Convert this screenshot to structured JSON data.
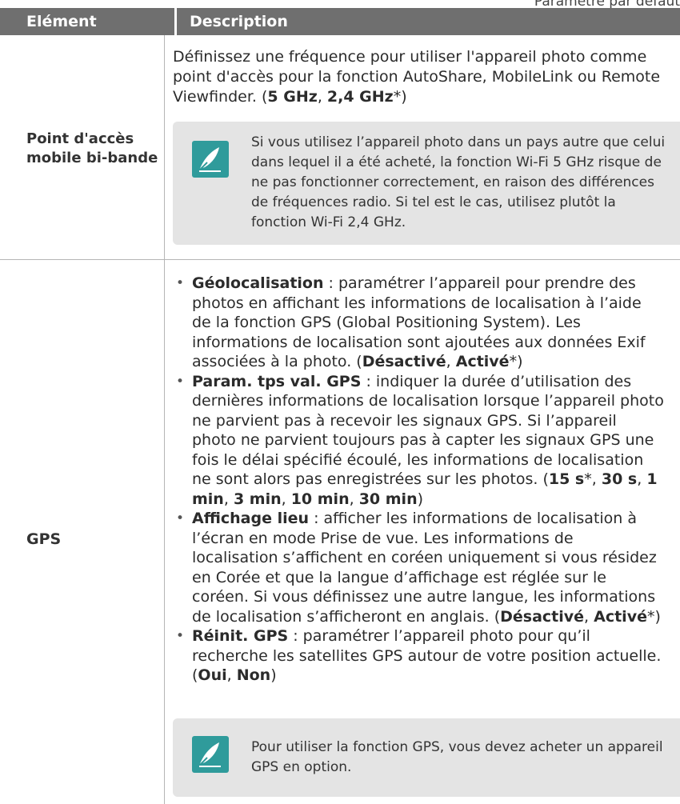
{
  "top_note": "Paramètre par défaut",
  "header": {
    "col1": "Elément",
    "col2": "Description"
  },
  "rows": [
    {
      "label_line1": "Point d'accès",
      "label_line2": "mobile bi-bande",
      "desc_intro": "Définissez une fréquence pour utiliser l'appareil photo comme point d'accès pour la fonction AutoShare, MobileLink ou Remote Viewfinder. (",
      "opt1": "5 GHz",
      "sep": ", ",
      "opt2": "2,4 GHz",
      "suffix": "*)",
      "note": "Si vous utilisez l’appareil photo dans un pays autre que celui dans lequel il a été acheté, la fonction Wi-Fi 5 GHz risque de ne pas fonctionner correctement, en raison des différences de fréquences radio. Si tel est le cas, utilisez plutôt la fonction Wi-Fi 2,4 GHz."
    },
    {
      "label": "GPS",
      "bullets": [
        {
          "title": "Géolocalisation",
          "text": " : paramétrer l’appareil pour prendre des photos en affichant les informations de localisation à l’aide de la fonction GPS (Global Positioning System). Les informations de localisation sont ajoutées aux données Exif associées à la photo. (",
          "o1": "Désactivé",
          "o2": "Activé",
          "end": "*)"
        },
        {
          "title": "Param. tps val. GPS",
          "text": " : indiquer la durée d’utilisation des dernières informations de localisation lorsque l’appareil photo ne parvient pas à recevoir les signaux GPS. Si l’appareil photo ne parvient toujours pas à capter les signaux GPS une fois le délai spécifié écoulé, les informations de localisation ne sont alors pas enregistrées sur les photos. (",
          "o1": "15 s",
          "star": "*",
          "o2": "30 s",
          "o3": "1 min",
          "o4": "3 min",
          "o5": "10 min",
          "o6": "30 min",
          "end": ")"
        },
        {
          "title": "Affichage lieu",
          "text": " : afficher les informations de localisation à l’écran en mode Prise de vue. Les informations de localisation s’affichent en coréen uniquement si vous résidez en Corée et que la langue d’affichage est réglée sur le coréen. Si vous définissez une autre langue, les informations de localisation s’afficheront en anglais. (",
          "o1": "Désactivé",
          "o2": "Activé",
          "end": "*)"
        },
        {
          "title": "Réinit. GPS",
          "text": " : paramétrer l’appareil photo pour qu’il recherche les satellites GPS autour de votre position actuelle. (",
          "o1": "Oui",
          "o2": "Non",
          "end": ")"
        }
      ],
      "note": "Pour utiliser la fonction GPS, vous devez acheter un appareil GPS en option."
    }
  ],
  "colors": {
    "header_bg": "#6f6f6f",
    "note_bg": "#e4e4e4",
    "icon_bg": "#2f9b9b"
  },
  "icons": [
    "note-pen-icon",
    "note-pen-icon"
  ]
}
